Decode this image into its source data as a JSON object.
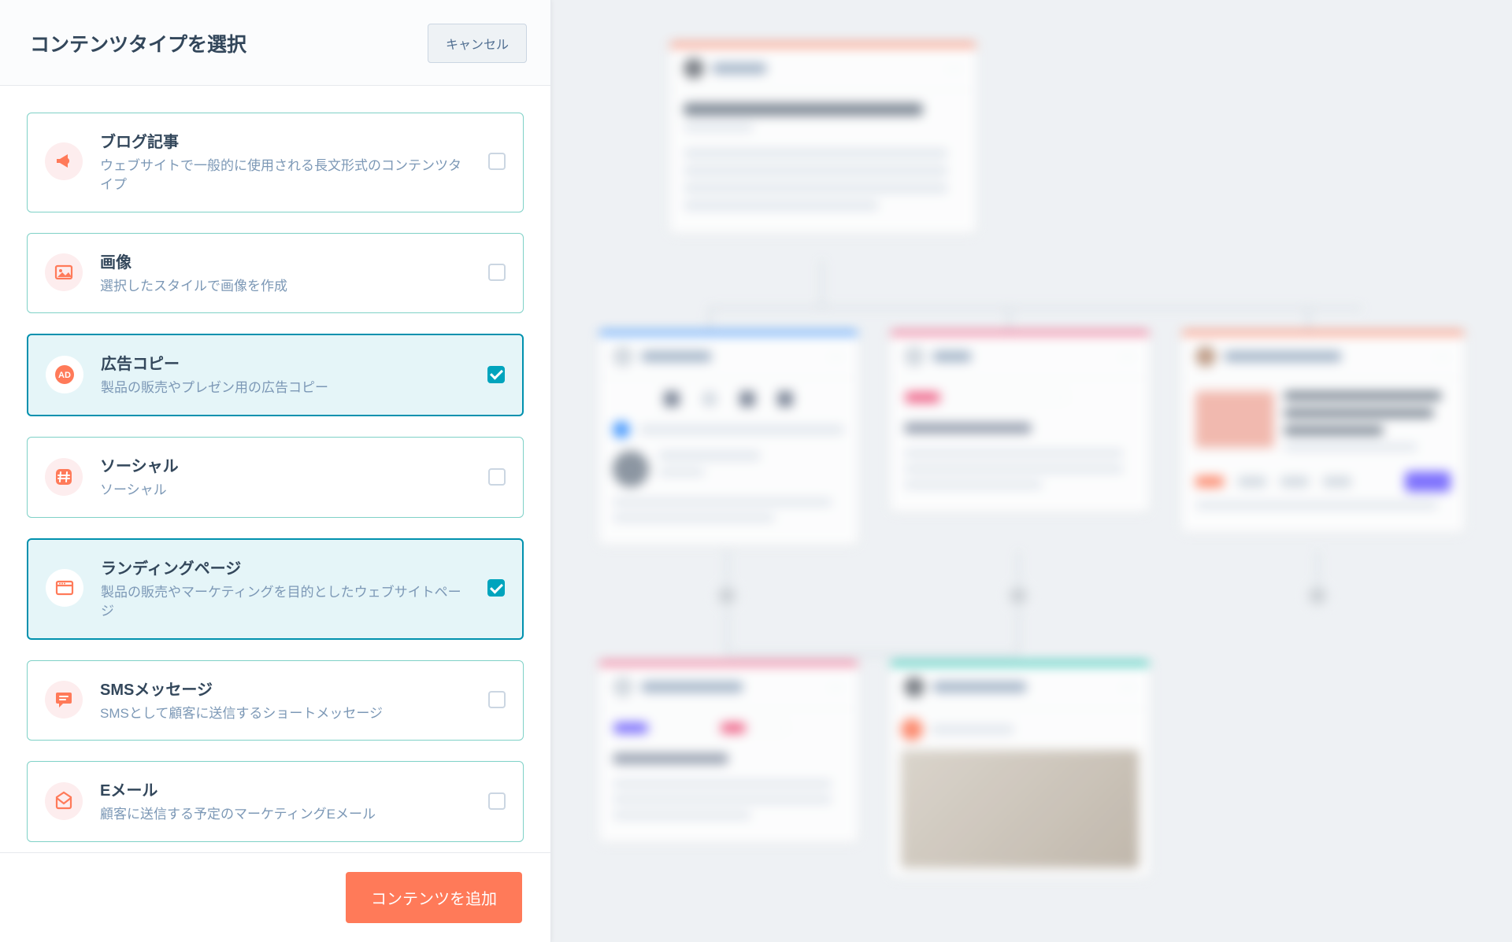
{
  "panel": {
    "title": "コンテンツタイプを選択",
    "cancel_label": "キャンセル",
    "add_label": "コンテンツを追加"
  },
  "options": [
    {
      "id": "blog",
      "icon": "megaphone-icon",
      "title": "ブログ記事",
      "desc": "ウェブサイトで一般的に使用される長文形式のコンテンツタイプ",
      "selected": false
    },
    {
      "id": "image",
      "icon": "image-icon",
      "title": "画像",
      "desc": "選択したスタイルで画像を作成",
      "selected": false
    },
    {
      "id": "ad",
      "icon": "ad-icon",
      "title": "広告コピー",
      "desc": "製品の販売やプレゼン用の広告コピー",
      "selected": true
    },
    {
      "id": "social",
      "icon": "hash-icon",
      "title": "ソーシャル",
      "desc": "ソーシャル",
      "selected": false
    },
    {
      "id": "landing",
      "icon": "window-icon",
      "title": "ランディングページ",
      "desc": "製品の販売やマーケティングを目的としたウェブサイトページ",
      "selected": true
    },
    {
      "id": "sms",
      "icon": "chat-icon",
      "title": "SMSメッセージ",
      "desc": "SMSとして顧客に送信するショートメッセージ",
      "selected": false
    },
    {
      "id": "email",
      "icon": "envelope-icon",
      "title": "Eメール",
      "desc": "顧客に送信する予定のマーケティングEメール",
      "selected": false
    }
  ],
  "canvas": {
    "node_colors": {
      "orange": "#ff7a59",
      "blue": "#2e8cff",
      "pink": "#f2547d",
      "teal": "#00bda5"
    }
  }
}
